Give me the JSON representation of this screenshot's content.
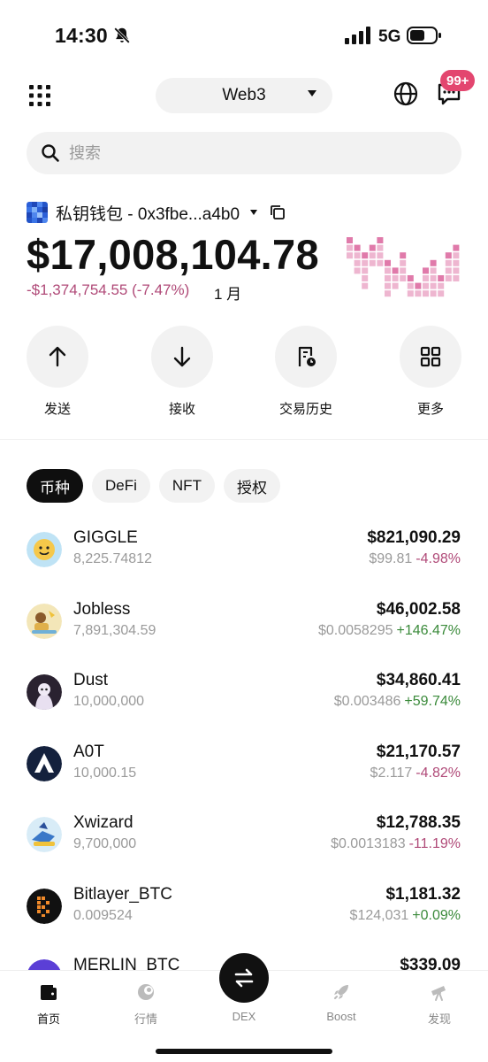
{
  "status_bar": {
    "time": "14:30",
    "network": "5G"
  },
  "top_bar": {
    "network_selector": "Web3",
    "notification_badge": "99+"
  },
  "search": {
    "placeholder": "搜索"
  },
  "wallet": {
    "name": "私钥钱包 - 0x3fbe...a4b0",
    "balance": "$17,008,104.78",
    "pnl": "-$1,374,754.55 (-7.47%)",
    "period": "1 月"
  },
  "actions": [
    {
      "label": "发送",
      "icon": "arrow-up-icon"
    },
    {
      "label": "接收",
      "icon": "arrow-down-icon"
    },
    {
      "label": "交易历史",
      "icon": "history-icon"
    },
    {
      "label": "更多",
      "icon": "grid-icon"
    }
  ],
  "tabs": [
    "币种",
    "DeFi",
    "NFT",
    "授权"
  ],
  "tokens": [
    {
      "name": "GIGGLE",
      "quantity": "8,225.74812",
      "value": "$821,090.29",
      "price": "$99.81",
      "change": "-4.98%"
    },
    {
      "name": "Jobless",
      "quantity": "7,891,304.59",
      "value": "$46,002.58",
      "price": "$0.0058295",
      "change": "+146.47%"
    },
    {
      "name": "Dust",
      "quantity": "10,000,000",
      "value": "$34,860.41",
      "price": "$0.003486",
      "change": "+59.74%"
    },
    {
      "name": "A0T",
      "quantity": "10,000.15",
      "value": "$21,170.57",
      "price": "$2.117",
      "change": "-4.82%"
    },
    {
      "name": "Xwizard",
      "quantity": "9,700,000",
      "value": "$12,788.35",
      "price": "$0.0013183",
      "change": "-11.19%"
    },
    {
      "name": "Bitlayer_BTC",
      "quantity": "0.009524",
      "value": "$1,181.32",
      "price": "$124,031",
      "change": "+0.09%"
    },
    {
      "name": "MERLIN_BTC",
      "quantity": "",
      "value": "$339.09",
      "price": "",
      "change": ""
    }
  ],
  "bottom_nav": [
    {
      "label": "首页",
      "icon": "wallet-icon"
    },
    {
      "label": "行情",
      "icon": "market-icon"
    },
    {
      "label": "DEX",
      "icon": "swap-icon"
    },
    {
      "label": "Boost",
      "icon": "rocket-icon"
    },
    {
      "label": "发现",
      "icon": "telescope-icon"
    }
  ],
  "colors": {
    "negative": "#b04a78",
    "positive": "#3a8a3a",
    "accent_badge": "#e3466f",
    "sparkline": "#e07aaa"
  }
}
